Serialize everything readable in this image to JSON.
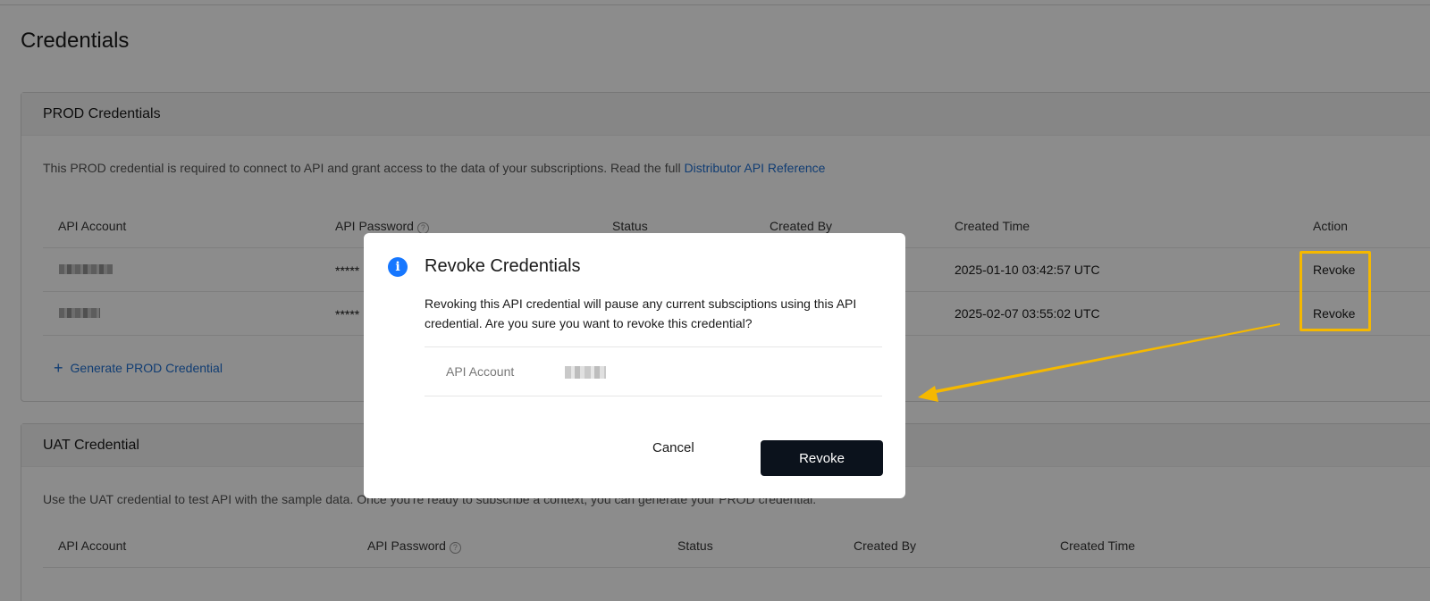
{
  "page": {
    "title": "Credentials"
  },
  "prod": {
    "title": "PROD Credentials",
    "description": "This PROD credential is required to connect to API and grant access to the data of your subscriptions. Read the full ",
    "link_text": "Distributor API Reference",
    "columns": [
      "API Account",
      "API Password",
      "Status",
      "Created By",
      "Created Time",
      "Action"
    ],
    "rows": [
      {
        "password": "*****",
        "created_time": "2025-01-10 03:42:57 UTC",
        "action": "Revoke"
      },
      {
        "password": "*****",
        "created_time": "2025-02-07 03:55:02 UTC",
        "action": "Revoke"
      }
    ],
    "generate_label": "Generate PROD Credential"
  },
  "uat": {
    "title": "UAT Credential",
    "description": "Use the UAT credential to test API with the sample data. Once you're ready to subscribe a context, you can generate your PROD credential.",
    "columns": [
      "API Account",
      "API Password",
      "Status",
      "Created By",
      "Created Time"
    ]
  },
  "modal": {
    "icon": "info-icon",
    "title": "Revoke Credentials",
    "text": "Revoking this API credential will pause any current subsciptions using this API credential. Are you sure you want to revoke this credential?",
    "field_label": "API Account",
    "cancel_label": "Cancel",
    "confirm_label": "Revoke"
  },
  "colors": {
    "accent": "#1f6fd1",
    "primary_button": "#0b121c",
    "annotation": "#f5b800",
    "info": "#1677ff"
  }
}
